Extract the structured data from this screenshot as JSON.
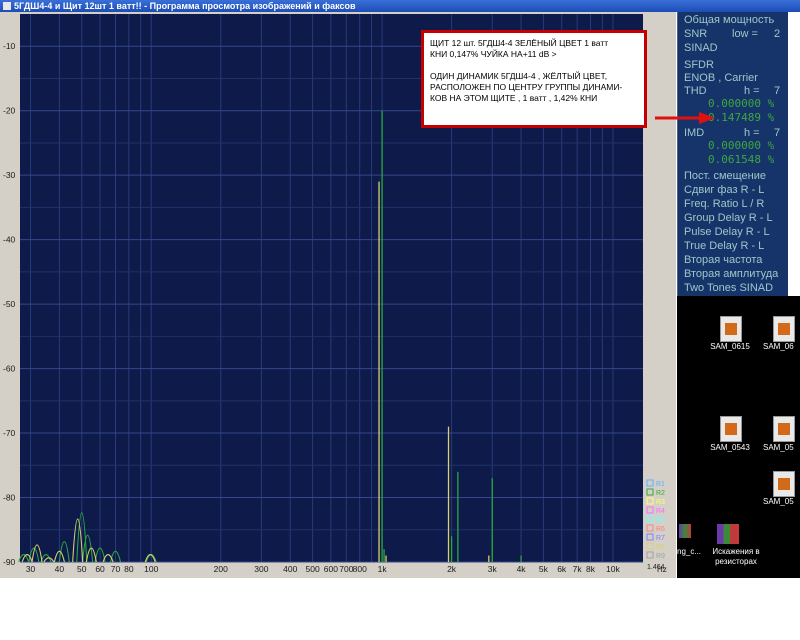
{
  "window": {
    "title": "5ГДШ4-4 и Щит 12шт  1 ватт!! - Программа просмотра изображений и факсов"
  },
  "chart_data": {
    "type": "line",
    "title": "",
    "xlabel": "",
    "ylabel": "",
    "x_scale": "log",
    "xlim": [
      27,
      13500
    ],
    "ylim": [
      -90,
      -5
    ],
    "grid": true,
    "x_ticks": [
      {
        "v": 30,
        "label": "30"
      },
      {
        "v": 40,
        "label": "40"
      },
      {
        "v": 50,
        "label": "50"
      },
      {
        "v": 60,
        "label": "60"
      },
      {
        "v": 70,
        "label": "70"
      },
      {
        "v": 80,
        "label": "80"
      },
      {
        "v": 100,
        "label": "100"
      },
      {
        "v": 200,
        "label": "200"
      },
      {
        "v": 300,
        "label": "300"
      },
      {
        "v": 400,
        "label": "400"
      },
      {
        "v": 500,
        "label": "500"
      },
      {
        "v": 600,
        "label": "600"
      },
      {
        "v": 700,
        "label": "700"
      },
      {
        "v": 800,
        "label": "800"
      },
      {
        "v": 1000,
        "label": "1k"
      },
      {
        "v": 2000,
        "label": "2k"
      },
      {
        "v": 3000,
        "label": "3k"
      },
      {
        "v": 4000,
        "label": "4k"
      },
      {
        "v": 5000,
        "label": "5k"
      },
      {
        "v": 6000,
        "label": "6k"
      },
      {
        "v": 7000,
        "label": "7k"
      },
      {
        "v": 8000,
        "label": "8k"
      },
      {
        "v": 10000,
        "label": "10k"
      }
    ],
    "x_unit": "Hz",
    "y_ticks": [
      -10,
      -20,
      -30,
      -40,
      -50,
      -60,
      -70,
      -80,
      -90
    ],
    "series": [
      {
        "color": "#2aa83a",
        "peaks": [
          {
            "x": 28,
            "y": -88
          },
          {
            "x": 31,
            "y": -86
          },
          {
            "x": 35,
            "y": -88
          },
          {
            "x": 42,
            "y": -84
          },
          {
            "x": 50,
            "y": -75
          },
          {
            "x": 53,
            "y": -82
          },
          {
            "x": 60,
            "y": -86
          },
          {
            "x": 70,
            "y": -87
          },
          {
            "x": 100,
            "y": -88
          },
          {
            "x": 1000,
            "y": -20
          },
          {
            "x": 1020,
            "y": -88
          },
          {
            "x": 2000,
            "y": -86
          },
          {
            "x": 2130,
            "y": -76
          },
          {
            "x": 3000,
            "y": -77
          },
          {
            "x": 4000,
            "y": -89
          }
        ]
      },
      {
        "color": "#d8d070",
        "peaks": [
          {
            "x": 29,
            "y": -88
          },
          {
            "x": 32,
            "y": -85
          },
          {
            "x": 36,
            "y": -89
          },
          {
            "x": 40,
            "y": -87
          },
          {
            "x": 48,
            "y": -77
          },
          {
            "x": 55,
            "y": -86
          },
          {
            "x": 65,
            "y": -88
          },
          {
            "x": 99,
            "y": -88
          },
          {
            "x": 970,
            "y": -31
          },
          {
            "x": 1040,
            "y": -89
          },
          {
            "x": 1940,
            "y": -69
          },
          {
            "x": 2900,
            "y": -89
          }
        ]
      }
    ],
    "legend": {
      "placement": "bottom-right",
      "items": [
        {
          "label": "R1",
          "color": "#5ab0ff"
        },
        {
          "label": "R2",
          "color": "#3aa83a"
        },
        {
          "label": "R3",
          "color": "#ffff66"
        },
        {
          "label": "R4",
          "color": "#ff66ff"
        },
        {
          "label": "R5",
          "color": "#66ffff"
        },
        {
          "label": "R6",
          "color": "#ff8080"
        },
        {
          "label": "R7",
          "color": "#8080ff"
        },
        {
          "label": "R8",
          "color": "#d8d070"
        },
        {
          "label": "R9",
          "color": "#a0a0a0"
        }
      ],
      "scale_value": "1.464"
    }
  },
  "annotation": {
    "lines": [
      "ЩИТ  12 шт. 5ГДШ4-4  ЗЕЛЁНЫЙ  ЦВЕТ  1 ватт",
      "КНИ 0,147% ЧУЙКА  НА+11 dB  >",
      "",
      "ОДИН ДИНАМИК 5ГДШ4-4 , ЖЁЛТЫЙ  ЦВЕТ,",
      "РАСПОЛОЖЕН  ПО ЦЕНТРУ ГРУППЫ  ДИНАМИ-",
      "КОВ  НА ЭТОМ  ЩИТЕ , 1 ватт  , 1,42%  КНИ"
    ]
  },
  "side_panel": {
    "total_power": "Общая мощность",
    "snr": "SNR",
    "low_label": "low =",
    "low_value": "2",
    "sinad": "SINAD",
    "sfdr": "SFDR",
    "enob": "ENOB , Carrier",
    "thd": "THD",
    "thd_h_label": "h =",
    "thd_h_value": "7",
    "thd_val1": "0.000000 %",
    "thd_val2": "0.147489 %",
    "imd": "IMD",
    "imd_h_label": "h =",
    "imd_h_value": "7",
    "imd_val1": "0.000000 %",
    "imd_val2": "0.061548 %",
    "dc_offset": "Пост. смещение",
    "phase_shift": "Сдвиг фаз R - L",
    "freq_ratio": "Freq. Ratio  L / R",
    "group_delay": "Group Delay R - L",
    "pulse_delay": "Pulse Delay R - L",
    "true_delay": "True Delay R - L",
    "second_freq": "Вторая частота",
    "second_amp": "Вторая амплитуда",
    "two_tones": "Two Tones SINAD"
  },
  "desktop": {
    "icons": [
      "SAM_0615",
      "SAM_06",
      "SAM_0543",
      "SAM_05",
      "SAM_05"
    ],
    "partial_label": "ng_c...",
    "folder_label_1": "Искажения в",
    "folder_label_2": "резисторах"
  }
}
